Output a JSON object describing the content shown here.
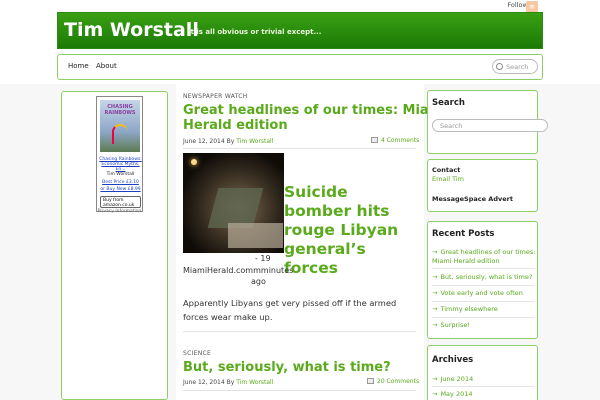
{
  "topbar": {
    "follow_label": "Follow Us",
    "rss_icon": "rss-icon"
  },
  "header": {
    "title": "Tim Worstall",
    "tagline": "It is all obvious or trivial except..."
  },
  "nav": {
    "items": [
      {
        "label": "Home"
      },
      {
        "label": "About"
      }
    ],
    "search_placeholder": "Search"
  },
  "ad": {
    "cover_title": "CHASING RAINBOWS",
    "link_title": "Chasing Rainbows: Economic Myths, En...",
    "author": "Tim Worstall",
    "best_price": "Best Price £3.10",
    "buy_new": "or Buy New £8.99",
    "buy_button": "Buy from amazon.co.uk",
    "privacy": "Privacy Information"
  },
  "posts": [
    {
      "category": "NEWSPAPER WATCH",
      "title_line1": "Great headlines of our times: Miami",
      "title_line2": "Herald edition",
      "date": "June 12, 2014",
      "by": "By",
      "author": "Tim Worstall",
      "comments": "4 Comments",
      "headline": "Suicide bomber hits rouge Libyan general’s forces",
      "src_dash": "- 19",
      "src_site": "MiamiHerald.commminutes",
      "src_ago": "ago",
      "excerpt": "Apparently Libyans get very pissed off if the armed forces wear make up."
    },
    {
      "category": "SCIENCE",
      "title": "But, seriously, what is time?",
      "date": "June 12, 2014",
      "by": "By",
      "author": "Tim Worstall",
      "comments": "20 Comments"
    }
  ],
  "sidebar": {
    "search_title": "Search",
    "search_placeholder": "Search",
    "contact_title": "Contact",
    "email_link": "Email Tim",
    "advert_title": "MessageSpace Advert",
    "recent_title": "Recent Posts",
    "recent": [
      {
        "label_line1": "Great headlines of our times:",
        "label_line2": "Miami Herald edition"
      },
      {
        "label_line1": "But, seriously, what is time?"
      },
      {
        "label_line1": "Vote early and vote often"
      },
      {
        "label_line1": "Timmy elsewhere"
      },
      {
        "label_line1": "Surprise!"
      }
    ],
    "archives_title": "Archives",
    "archives": [
      {
        "label": "June 2014"
      },
      {
        "label": "May 2014"
      }
    ]
  }
}
